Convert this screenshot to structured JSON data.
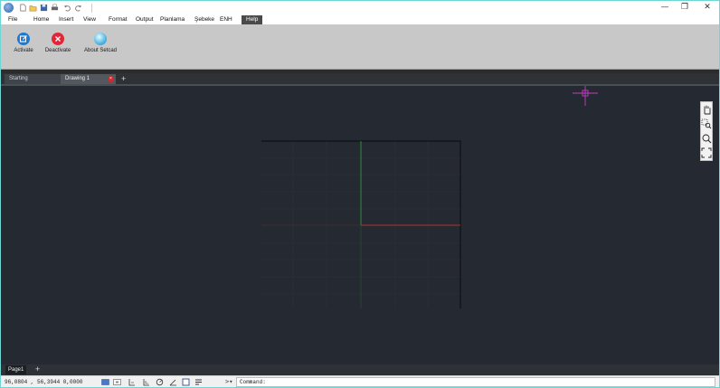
{
  "window": {
    "minimize_icon": "minimize-icon",
    "maximize_icon": "restore-icon",
    "close_icon": "close-icon"
  },
  "quick_access": [
    "new-file-icon",
    "open-folder-icon",
    "save-icon",
    "print-icon",
    "undo-icon",
    "redo-icon"
  ],
  "menu": {
    "items": [
      {
        "label": "File"
      },
      {
        "label": "Home"
      },
      {
        "label": "Insert"
      },
      {
        "label": "View"
      },
      {
        "label": "Format"
      },
      {
        "label": "Output"
      },
      {
        "label": "Planlama"
      },
      {
        "label": "Şebeke"
      },
      {
        "label": "ENH"
      },
      {
        "label": "Help"
      }
    ],
    "active": "Help"
  },
  "ribbon": {
    "buttons": [
      {
        "label": "Activate",
        "icon": "activate-icon"
      },
      {
        "label": "Deactivate",
        "icon": "deactivate-icon"
      },
      {
        "label": "About Setcad",
        "icon": "about-globe-icon"
      }
    ]
  },
  "tabs": [
    {
      "label": "Starting"
    },
    {
      "label": "Drawing 1",
      "active": true
    }
  ],
  "tab_close_glyph": "×",
  "add_glyph": "+",
  "viewbar": [
    "pan-hand-icon",
    "zoom-window-icon",
    "zoom-realtime-icon",
    "zoom-extents-icon"
  ],
  "pages": [
    {
      "label": "Page1"
    }
  ],
  "status": {
    "coordinates": "96,0804 , 56,3944  0,0000",
    "command_prompt": ">▾",
    "command_label": "Command:"
  },
  "colors": {
    "canvas_bg": "#252a32",
    "x_axis": "#b03030",
    "y_axis": "#2f8a3c",
    "cursor": "#c43cc4",
    "menu_active_bg": "#4a4a4a"
  }
}
